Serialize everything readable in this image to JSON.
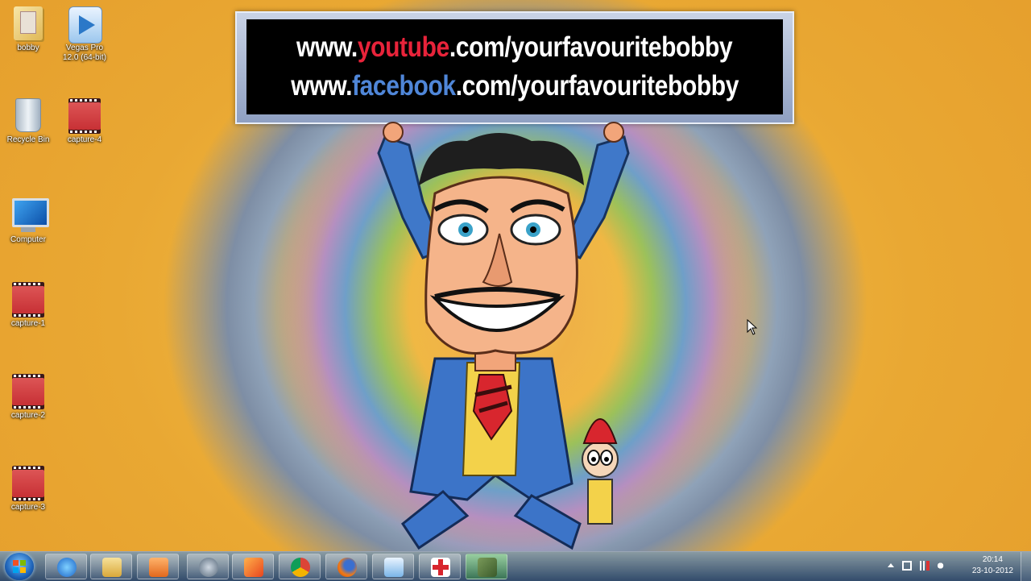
{
  "banner": {
    "line1": {
      "pre": "www.",
      "brand": "youtube",
      "post": ".com/yourfavouritebobby"
    },
    "line2": {
      "pre": "www.",
      "brand": "facebook",
      "post": ".com/yourfavouritebobby"
    }
  },
  "desktop_icons": [
    {
      "label": "bobby",
      "icon": "folder-icon"
    },
    {
      "label": "Vegas Pro 12.0 (64-bit)",
      "icon": "vegas-pro-icon"
    },
    {
      "label": "Recycle Bin",
      "icon": "recycle-bin-icon"
    },
    {
      "label": "capture-4",
      "icon": "video-file-icon"
    },
    {
      "label": "Computer",
      "icon": "computer-icon"
    },
    {
      "label": "capture-1",
      "icon": "video-file-icon"
    },
    {
      "label": "capture-2",
      "icon": "video-file-icon"
    },
    {
      "label": "capture-3",
      "icon": "video-file-icon"
    }
  ],
  "taskbar": {
    "pinned": [
      "internet-explorer-icon",
      "file-explorer-icon",
      "media-player-icon",
      "hp-icon",
      "office-icon",
      "chrome-icon",
      "firefox-icon",
      "vegas-pro-icon",
      "plus-app-icon",
      "app-icon"
    ],
    "clock": {
      "time": "20:14",
      "date": "23-10-2012"
    }
  },
  "colors": {
    "youtube_red": "#e8233a",
    "facebook_blue": "#4f86d8"
  }
}
